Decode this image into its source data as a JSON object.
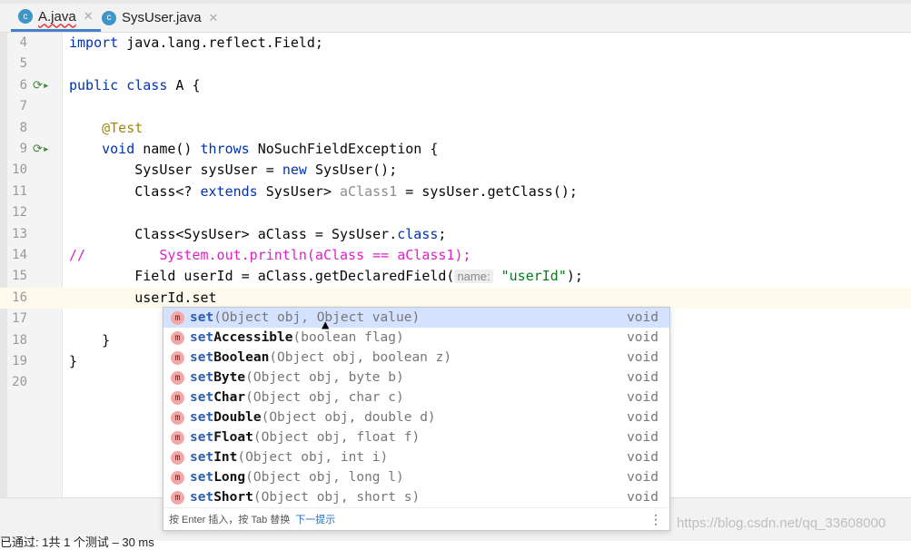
{
  "tabs": [
    {
      "label": "A.java",
      "icon": "c",
      "active": true
    },
    {
      "label": "SysUser.java",
      "icon": "c",
      "active": false
    }
  ],
  "lines": [
    {
      "n": "4",
      "tokens": [
        [
          "kw",
          "import "
        ],
        [
          "",
          "java.lang.reflect.Field;"
        ]
      ]
    },
    {
      "n": "5",
      "tokens": []
    },
    {
      "n": "6",
      "run": true,
      "tokens": [
        [
          "kw",
          "public class "
        ],
        [
          "",
          "A {"
        ]
      ]
    },
    {
      "n": "7",
      "tokens": []
    },
    {
      "n": "8",
      "tokens": [
        [
          "",
          "    "
        ],
        [
          "ann",
          "@Test"
        ]
      ]
    },
    {
      "n": "9",
      "run": true,
      "tokens": [
        [
          "",
          "    "
        ],
        [
          "kw",
          "void "
        ],
        [
          "",
          "name() "
        ],
        [
          "kw",
          "throws "
        ],
        [
          "",
          "NoSuchFieldException {"
        ]
      ]
    },
    {
      "n": "10",
      "tokens": [
        [
          "",
          "        SysUser sysUser = "
        ],
        [
          "kw",
          "new "
        ],
        [
          "",
          "SysUser();"
        ]
      ]
    },
    {
      "n": "11",
      "tokens": [
        [
          "",
          "        Class<? "
        ],
        [
          "kw",
          "extends "
        ],
        [
          "",
          "SysUser> "
        ],
        [
          "gray",
          "aClass1"
        ],
        [
          "",
          " = sysUser.getClass();"
        ]
      ]
    },
    {
      "n": "12",
      "tokens": []
    },
    {
      "n": "13",
      "tokens": [
        [
          "",
          "        Class<SysUser> aClass = SysUser."
        ],
        [
          "kw",
          "class"
        ],
        [
          "",
          ";"
        ]
      ]
    },
    {
      "n": "14",
      "tokens": [
        [
          "cm",
          "//         System.out.println(aClass == aClass1);"
        ]
      ]
    },
    {
      "n": "15",
      "tokens": [
        [
          "",
          "        Field userId = aClass.getDeclaredField("
        ],
        [
          "hint",
          "name:"
        ],
        [
          "",
          ""
        ],
        [
          "str",
          " \"userId\""
        ],
        [
          "",
          ");"
        ]
      ]
    },
    {
      "n": "16",
      "current": true,
      "tokens": [
        [
          "",
          "        userId.set"
        ]
      ]
    },
    {
      "n": "17",
      "tokens": []
    },
    {
      "n": "18",
      "tokens": [
        [
          "",
          "    }"
        ]
      ]
    },
    {
      "n": "19",
      "tokens": [
        [
          "",
          "}"
        ]
      ]
    },
    {
      "n": "20",
      "tokens": []
    }
  ],
  "completion": {
    "items": [
      {
        "prefix": "set",
        "rest": "",
        "args": "(Object obj, Object value)",
        "ret": "void"
      },
      {
        "prefix": "set",
        "rest": "Accessible",
        "args": "(boolean flag)",
        "ret": "void"
      },
      {
        "prefix": "set",
        "rest": "Boolean",
        "args": "(Object obj, boolean z)",
        "ret": "void"
      },
      {
        "prefix": "set",
        "rest": "Byte",
        "args": "(Object obj, byte b)",
        "ret": "void"
      },
      {
        "prefix": "set",
        "rest": "Char",
        "args": "(Object obj, char c)",
        "ret": "void"
      },
      {
        "prefix": "set",
        "rest": "Double",
        "args": "(Object obj, double d)",
        "ret": "void"
      },
      {
        "prefix": "set",
        "rest": "Float",
        "args": "(Object obj, float f)",
        "ret": "void"
      },
      {
        "prefix": "set",
        "rest": "Int",
        "args": "(Object obj, int i)",
        "ret": "void"
      },
      {
        "prefix": "set",
        "rest": "Long",
        "args": "(Object obj, long l)",
        "ret": "void"
      },
      {
        "prefix": "set",
        "rest": "Short",
        "args": "(Object obj, short s)",
        "ret": "void"
      }
    ],
    "footer": "按 Enter 插入，按 Tab 替换",
    "footer_link": "下一提示"
  },
  "status": {
    "text": "已通过: 1共 1 个测试 – 30 ms"
  },
  "watermark": "https://blog.csdn.net/qq_33608000",
  "colors": {
    "accent": "#4083c9",
    "selection": "#d4e2ff",
    "keyword": "#0033b3",
    "comment": "#e020c8"
  }
}
